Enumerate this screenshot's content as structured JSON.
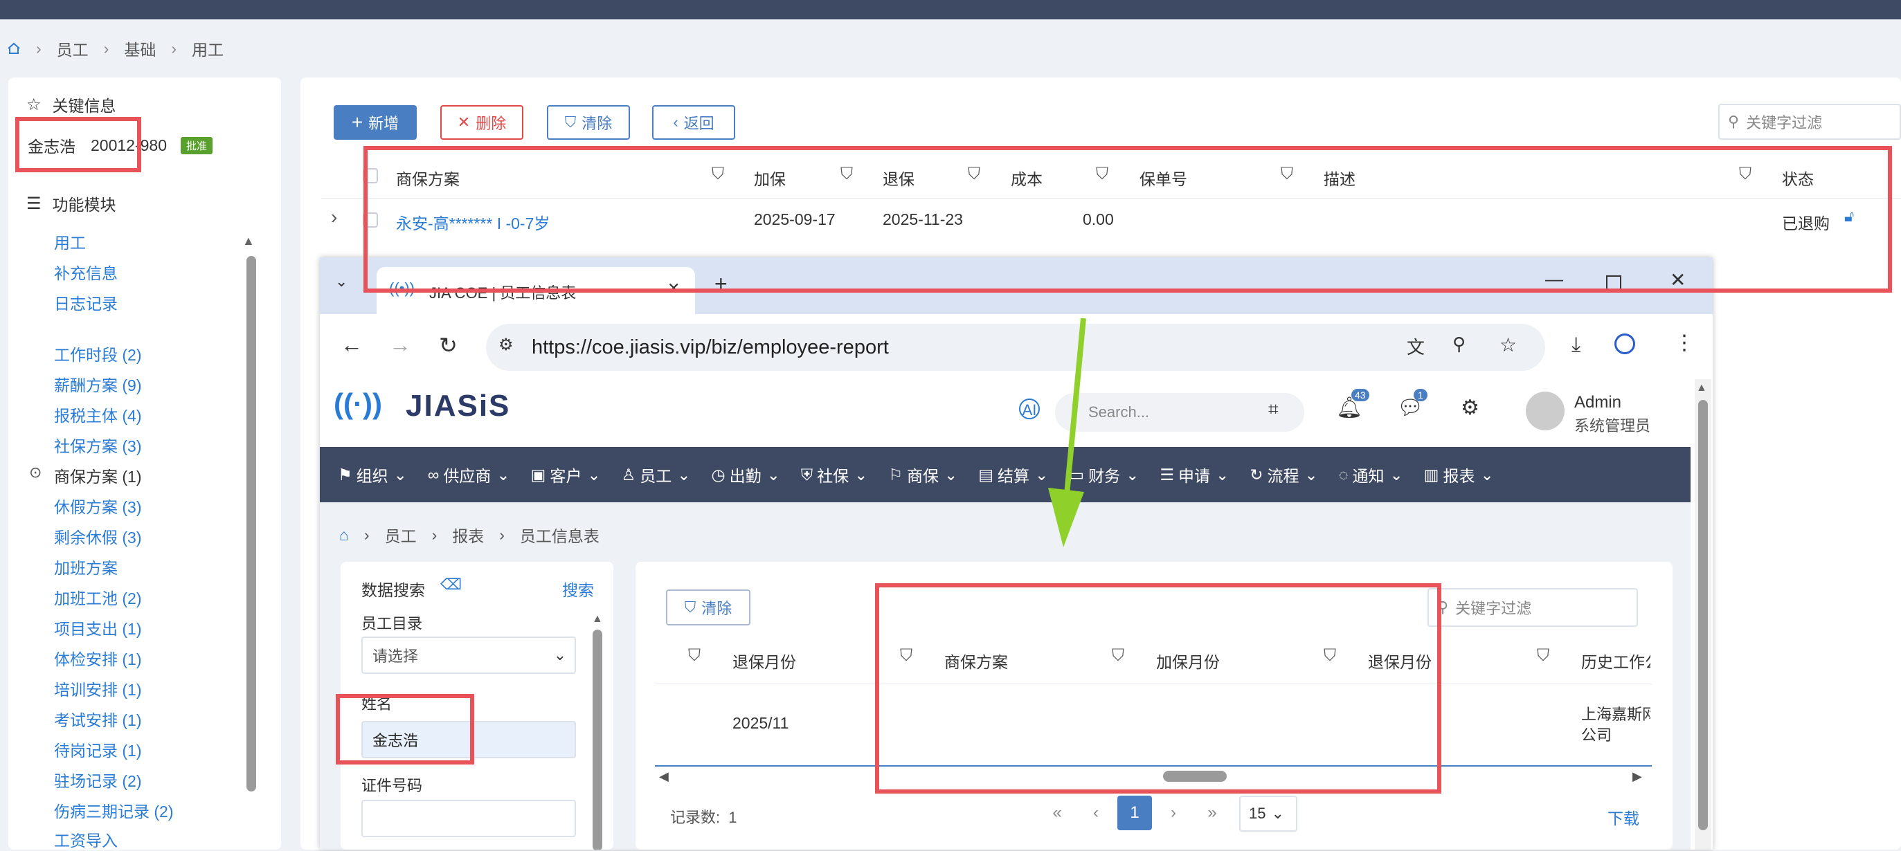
{
  "breadcrumb": [
    "员工",
    "基础",
    "用工"
  ],
  "left": {
    "key_info_title": "关键信息",
    "employee_name": "金志浩",
    "employee_id": "20012-980",
    "status_badge": "批准",
    "modules_title": "功能模块",
    "menu": [
      "用工",
      "补充信息",
      "日志记录",
      "工作时段 (2)",
      "薪酬方案 (9)",
      "报税主体 (4)",
      "社保方案 (3)",
      "商保方案 (1)",
      "休假方案 (3)",
      "剩余休假 (3)",
      "加班方案",
      "加班工池 (2)",
      "项目支出 (1)",
      "体检安排 (1)",
      "培训安排 (1)",
      "考试安排 (1)",
      "待岗记录 (1)",
      "驻场记录 (2)",
      "伤病三期记录 (2)",
      "工资导入"
    ]
  },
  "toolbar": {
    "add": "新增",
    "delete": "删除",
    "clear": "清除",
    "back": "返回",
    "search_placeholder": "关键字过滤"
  },
  "table": {
    "columns": [
      "商保方案",
      "加保",
      "退保",
      "成本",
      "保单号",
      "描述",
      "状态"
    ],
    "row": {
      "plan": "永安-高******* I -0-7岁",
      "add_date": "2025-09-17",
      "exit_date": "2025-11-23",
      "cost": "0.00",
      "policy": "",
      "desc": "",
      "status": "已退购"
    }
  },
  "browser": {
    "tab_title": "JIA COE | 员工信息表",
    "url": "https://coe.jiasis.vip/biz/employee-report",
    "logo": "JIASiS",
    "search_placeholder": "Search...",
    "notif_count": "43",
    "msg_count": "1",
    "user_name": "Admin",
    "user_role": "系统管理员",
    "nav": [
      "组织",
      "供应商",
      "客户",
      "员工",
      "出勤",
      "社保",
      "商保",
      "结算",
      "财务",
      "申请",
      "流程",
      "通知",
      "报表"
    ],
    "breadcrumb": [
      "员工",
      "报表",
      "员工信息表"
    ],
    "search_panel": {
      "title": "数据搜索",
      "search_link": "搜索",
      "dir_label": "员工目录",
      "dir_placeholder": "请选择",
      "name_label": "姓名",
      "name_value": "金志浩",
      "id_label": "证件号码"
    },
    "report": {
      "clear": "清除",
      "search_placeholder": "关键字过滤",
      "columns": [
        "退保月份",
        "商保方案",
        "加保月份",
        "退保月份",
        "历史工作公"
      ],
      "row": {
        "exit_month": "2025/11",
        "history": "上海嘉斯网\n公司"
      },
      "record_label": "记录数:",
      "record_count": "1",
      "page": "1",
      "page_size": "15",
      "download": "下载"
    }
  }
}
